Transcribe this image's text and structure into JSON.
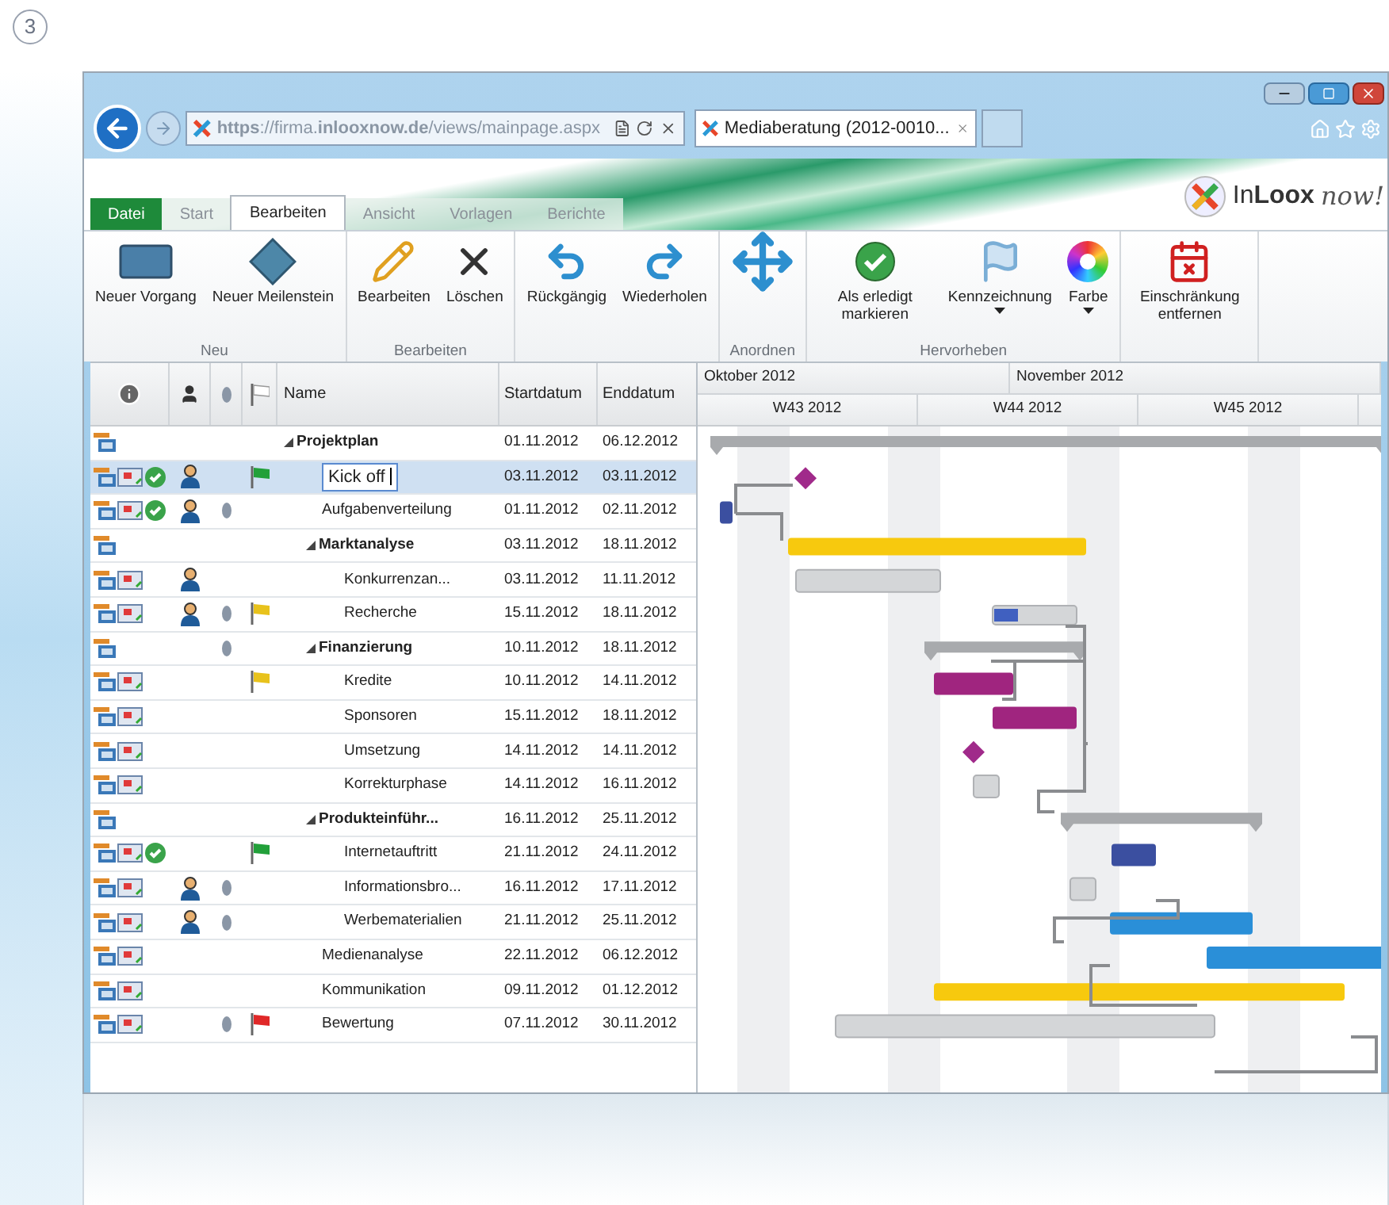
{
  "step_marker": "3",
  "browser": {
    "url": "**https**://firma.**inlooxnow.de**/views/mainpage.aspx",
    "tab_title": "Mediaberatung (2012-0010..."
  },
  "logo": {
    "name": "In**Loox**",
    "tagline": "now!"
  },
  "ribbon_tabs": [
    {
      "label": "Datei",
      "kind": "file",
      "selected": false
    },
    {
      "label": "Start",
      "kind": "tab",
      "selected": false
    },
    {
      "label": "Bearbeiten",
      "kind": "tab",
      "selected": true
    },
    {
      "label": "Ansicht",
      "kind": "tab",
      "selected": false
    },
    {
      "label": "Vorlagen",
      "kind": "tab",
      "selected": false
    },
    {
      "label": "Berichte",
      "kind": "tab",
      "selected": false
    }
  ],
  "ribbon_groups": [
    {
      "label": "Neu",
      "buttons": [
        {
          "label": "Neuer Vorgang",
          "kind": "task"
        },
        {
          "label": "Neuer Meilenstein",
          "kind": "milestone"
        }
      ]
    },
    {
      "label": "Bearbeiten",
      "buttons": [
        {
          "label": "Bearbeiten",
          "kind": "edit"
        },
        {
          "label": "Löschen",
          "kind": "delete"
        }
      ]
    },
    {
      "buttons": [
        {
          "label": "Rückgängig",
          "kind": "undo"
        },
        {
          "label": "Wiederholen",
          "kind": "redo"
        }
      ]
    },
    {
      "label": "Anordnen",
      "buttons": [
        {
          "kind": "move"
        }
      ]
    },
    {
      "label": "Hervorheben",
      "buttons": [
        {
          "label": "Als erledigt markieren",
          "kind": "done"
        },
        {
          "label": "Kennzeichnung",
          "kind": "flag",
          "menu": true
        },
        {
          "label": "Farbe",
          "kind": "color",
          "menu": true
        }
      ]
    },
    {
      "buttons": [
        {
          "label": "Einschränkung entfernen",
          "kind": "constraint"
        }
      ]
    }
  ],
  "table": {
    "columns": [
      "Name",
      "Startdatum",
      "Enddatum"
    ],
    "rows": [
      {
        "name": "Projektplan",
        "kind": "summary",
        "expanded": true,
        "attachment": false,
        "start": "01.11.2012",
        "end": "06.12.2012",
        "selected": false,
        "children": [
          {
            "name": "Kick off",
            "kind": "task",
            "done": true,
            "assignee": true,
            "attachment": false,
            "color": "#22a03a",
            "start": "03.11.2012",
            "end": "03.11.2012",
            "selected": true
          },
          {
            "name": "Aufgabenverteilung",
            "kind": "task",
            "done": true,
            "assignee": true,
            "attachment": true,
            "start": "01.11.2012",
            "end": "02.11.2012",
            "selected": false
          },
          {
            "name": "Marktanalyse",
            "kind": "summary",
            "expanded": true,
            "attachment": false,
            "start": "03.11.2012",
            "end": "18.11.2012",
            "selected": false,
            "children": [
              {
                "name": "Konkurrenzan...",
                "kind": "task",
                "done": false,
                "assignee": true,
                "attachment": false,
                "start": "03.11.2012",
                "end": "11.11.2012",
                "selected": false
              },
              {
                "name": "Recherche",
                "kind": "task",
                "done": false,
                "assignee": true,
                "attachment": true,
                "color": "#e8c21c",
                "start": "15.11.2012",
                "end": "18.11.2012",
                "selected": false
              }
            ]
          },
          {
            "name": "Finanzierung",
            "kind": "summary",
            "expanded": true,
            "attachment": true,
            "start": "10.11.2012",
            "end": "18.11.2012",
            "selected": false,
            "children": [
              {
                "name": "Kredite",
                "kind": "task",
                "done": false,
                "assignee": false,
                "attachment": false,
                "color": "#e8c21c",
                "start": "10.11.2012",
                "end": "14.11.2012",
                "selected": false
              },
              {
                "name": "Sponsoren",
                "kind": "task",
                "done": false,
                "assignee": false,
                "attachment": false,
                "start": "15.11.2012",
                "end": "18.11.2012",
                "selected": false
              },
              {
                "name": "Umsetzung",
                "kind": "task",
                "done": false,
                "assignee": false,
                "attachment": false,
                "start": "14.11.2012",
                "end": "14.11.2012",
                "selected": false
              },
              {
                "name": "Korrekturphase",
                "kind": "task",
                "done": false,
                "assignee": false,
                "attachment": false,
                "start": "14.11.2012",
                "end": "16.11.2012",
                "selected": false
              }
            ]
          },
          {
            "name": "Produkteinführ...",
            "kind": "summary",
            "expanded": true,
            "attachment": false,
            "start": "16.11.2012",
            "end": "25.11.2012",
            "selected": false,
            "children": [
              {
                "name": "Internetauftritt",
                "kind": "task",
                "done": true,
                "assignee": false,
                "attachment": false,
                "color": "#22a03a",
                "start": "21.11.2012",
                "end": "24.11.2012",
                "selected": false
              },
              {
                "name": "Informationsbro...",
                "kind": "task",
                "done": false,
                "assignee": true,
                "attachment": true,
                "start": "16.11.2012",
                "end": "17.11.2012",
                "selected": false
              },
              {
                "name": "Werbematerialien",
                "kind": "task",
                "done": false,
                "assignee": true,
                "attachment": true,
                "start": "21.11.2012",
                "end": "25.11.2012",
                "selected": false
              }
            ]
          },
          {
            "name": "Medienanalyse",
            "kind": "task",
            "done": false,
            "assignee": false,
            "attachment": false,
            "start": "22.11.2012",
            "end": "06.12.2012",
            "selected": false
          },
          {
            "name": "Kommunikation",
            "kind": "task",
            "done": false,
            "assignee": false,
            "attachment": false,
            "start": "09.11.2012",
            "end": "01.12.2012",
            "selected": false
          },
          {
            "name": "Bewertung",
            "kind": "task",
            "done": false,
            "assignee": false,
            "attachment": true,
            "color": "#e02828",
            "start": "07.11.2012",
            "end": "30.11.2012",
            "selected": false
          }
        ]
      }
    ]
  },
  "gantt": {
    "months": [
      "Oktober 2012",
      "November 2012"
    ],
    "weeks": [
      "W43 2012",
      "W44 2012",
      "W45 2012"
    ]
  }
}
